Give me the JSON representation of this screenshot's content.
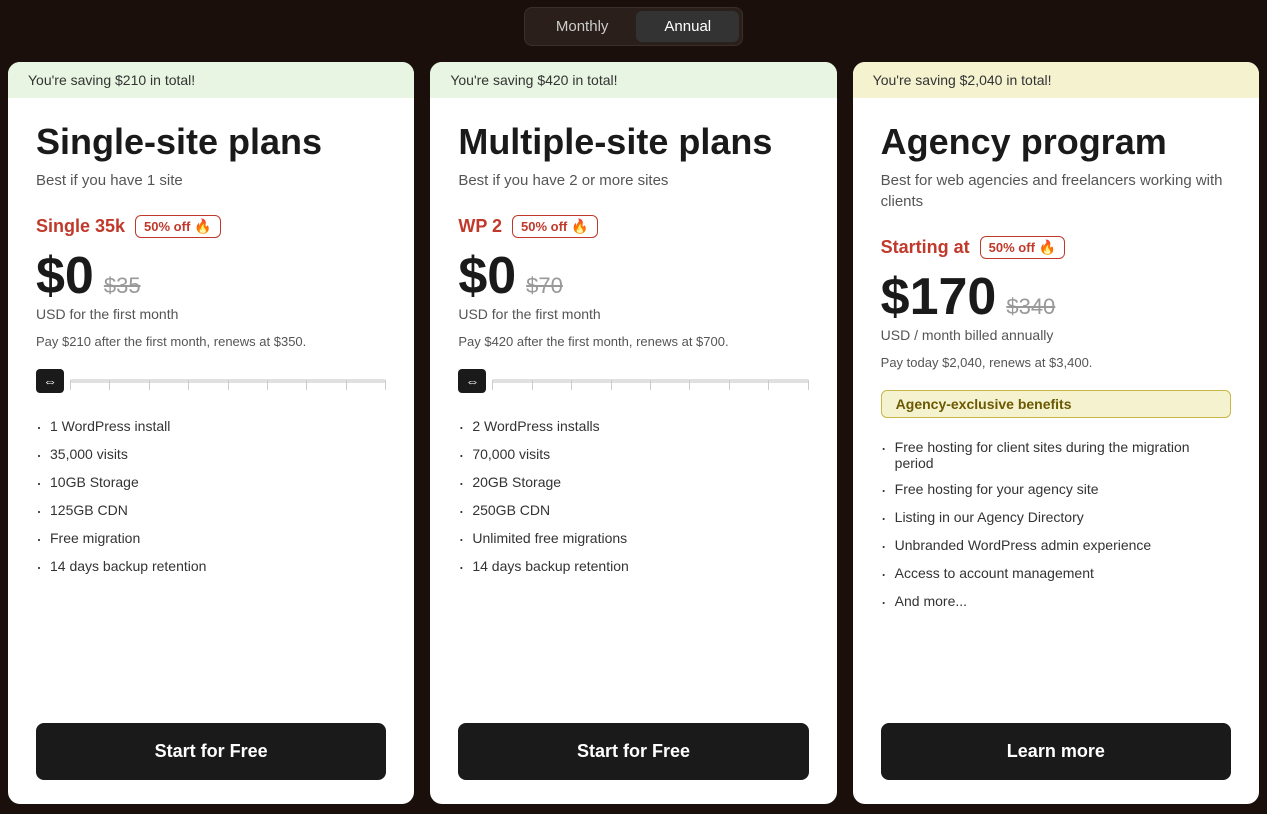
{
  "header": {
    "toggle": {
      "monthly_label": "Monthly",
      "annual_label": "Annual",
      "active": "annual"
    }
  },
  "cards": [
    {
      "id": "single-site",
      "savings_banner": "You're saving $210 in total!",
      "savings_color": "green",
      "title": "Single-site plans",
      "subtitle": "Best if you have 1 site",
      "plan_name": "Single 35k",
      "discount_label": "50% off",
      "price_current": "$0",
      "price_original": "$35",
      "price_period": "USD for the first month",
      "price_note": "Pay $210 after the first month, renews at $350.",
      "features": [
        "1 WordPress install",
        "35,000 visits",
        "10GB Storage",
        "125GB CDN",
        "Free migration",
        "14 days backup retention"
      ],
      "cta_label": "Start for Free",
      "has_slider": true,
      "has_agency_badge": false
    },
    {
      "id": "multiple-site",
      "savings_banner": "You're saving $420 in total!",
      "savings_color": "green",
      "title": "Multiple-site plans",
      "subtitle": "Best if you have 2 or more sites",
      "plan_name": "WP 2",
      "discount_label": "50% off",
      "price_current": "$0",
      "price_original": "$70",
      "price_period": "USD for the first month",
      "price_note": "Pay $420 after the first month, renews at $700.",
      "features": [
        "2 WordPress installs",
        "70,000 visits",
        "20GB Storage",
        "250GB CDN",
        "Unlimited free migrations",
        "14 days backup retention"
      ],
      "cta_label": "Start for Free",
      "has_slider": true,
      "has_agency_badge": false
    },
    {
      "id": "agency",
      "savings_banner": "You're saving $2,040 in total!",
      "savings_color": "yellow",
      "title": "Agency program",
      "subtitle": "Best for web agencies and freelancers working with clients",
      "plan_name": "Starting at",
      "discount_label": "50% off",
      "price_current": "$170",
      "price_original": "$340",
      "price_period": "USD / month billed annually",
      "price_note": "Pay today $2,040, renews at $3,400.",
      "agency_badge_label": "Agency-exclusive benefits",
      "features": [
        "Free hosting for client sites during the migration period",
        "Free hosting for your agency site",
        "Listing in our Agency Directory",
        "Unbranded WordPress admin experience",
        "Access to account management",
        "And more..."
      ],
      "cta_label": "Learn more",
      "has_slider": false,
      "has_agency_badge": true
    }
  ]
}
